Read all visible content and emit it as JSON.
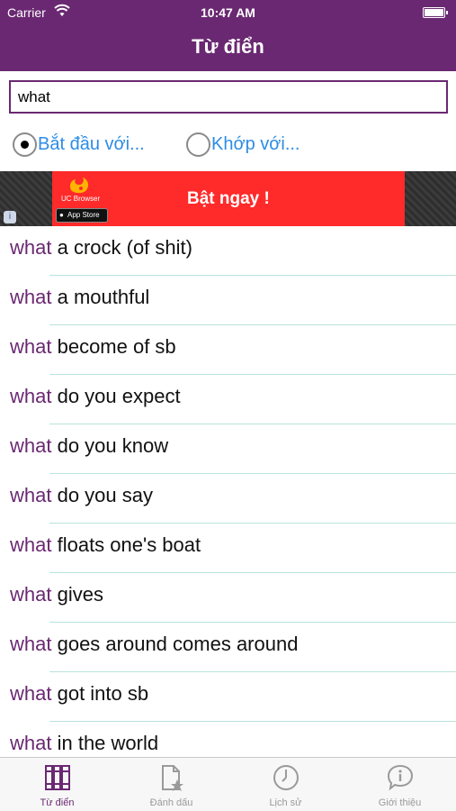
{
  "status_bar": {
    "carrier": "Carrier",
    "time": "10:47 AM"
  },
  "nav": {
    "title": "Từ điển"
  },
  "search": {
    "value": "what"
  },
  "mode": {
    "options": [
      {
        "label": "Bắt đầu với...",
        "selected": true
      },
      {
        "label": "Khớp với...",
        "selected": false
      }
    ]
  },
  "ad": {
    "brand": "UC Browser",
    "store_badge": "App Store",
    "cta": "Bật ngay !",
    "info": "i"
  },
  "results": [
    {
      "hl": "what",
      "rest": " a crock (of shit)"
    },
    {
      "hl": "what",
      "rest": " a mouthful"
    },
    {
      "hl": "what",
      "rest": " become of sb"
    },
    {
      "hl": "what",
      "rest": " do you expect"
    },
    {
      "hl": "what",
      "rest": " do you know"
    },
    {
      "hl": "what",
      "rest": " do you say"
    },
    {
      "hl": "what",
      "rest": " floats one's boat"
    },
    {
      "hl": "what",
      "rest": " gives"
    },
    {
      "hl": "what",
      "rest": " goes around comes around"
    },
    {
      "hl": "what",
      "rest": " got into sb"
    },
    {
      "hl": "what",
      "rest": " in the world"
    }
  ],
  "tabs": [
    {
      "label": "Từ điển",
      "icon": "books-icon",
      "active": true
    },
    {
      "label": "Đánh dấu",
      "icon": "bookmark-star-icon",
      "active": false
    },
    {
      "label": "Lịch sử",
      "icon": "clock-icon",
      "active": false
    },
    {
      "label": "Giới thiệu",
      "icon": "info-icon",
      "active": false
    }
  ],
  "colors": {
    "brand": "#6a2872",
    "link": "#2d8ce6",
    "ad": "#ff2a2a",
    "divider": "#b9e3dc"
  }
}
